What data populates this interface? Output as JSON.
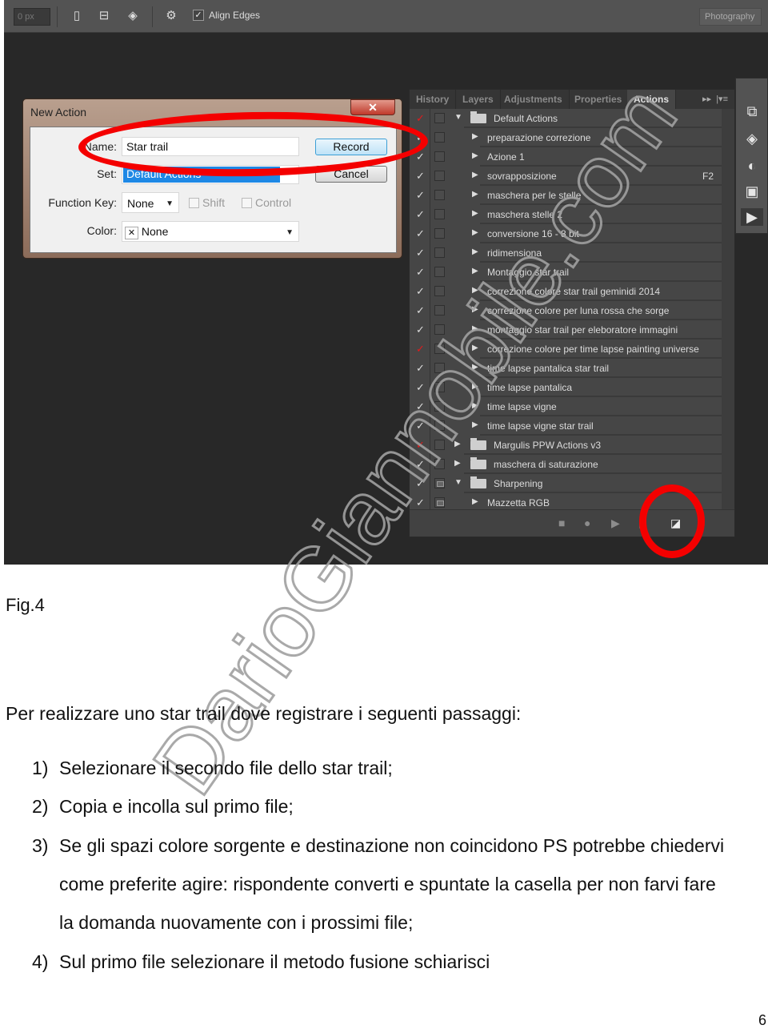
{
  "toolbar": {
    "px_value": "0 px",
    "align_edges_label": "Align Edges",
    "align_edges_checked": true,
    "workspace": "Photography"
  },
  "dialog": {
    "title": "New Action",
    "close": "✕",
    "name_label": "Name:",
    "name_value": "Star trail",
    "set_label": "Set:",
    "set_value": "Default Actions",
    "function_key_label": "Function Key:",
    "function_key_value": "None",
    "shift_label": "Shift",
    "control_label": "Control",
    "color_label": "Color:",
    "color_value": "None",
    "record": "Record",
    "cancel": "Cancel"
  },
  "panel": {
    "tabs": [
      "History",
      "Layers",
      "Adjustments",
      "Properties",
      "Actions"
    ],
    "active_tab": "Actions",
    "rows": [
      {
        "type": "set",
        "name": "Default Actions",
        "check": "red",
        "expanded": true
      },
      {
        "type": "action",
        "name": "preparazione correzione",
        "check": "white"
      },
      {
        "type": "action",
        "name": "Azione 1",
        "check": "white"
      },
      {
        "type": "action",
        "name": "sovrapposizione",
        "check": "white",
        "fkey": "F2"
      },
      {
        "type": "action",
        "name": "maschera per le stelle",
        "check": "white"
      },
      {
        "type": "action",
        "name": "maschera stelle 2",
        "check": "white"
      },
      {
        "type": "action",
        "name": "conversione 16 - 8 bit",
        "check": "white"
      },
      {
        "type": "action",
        "name": "ridimensiona",
        "check": "white"
      },
      {
        "type": "action",
        "name": "Montaggio star trail",
        "check": "white"
      },
      {
        "type": "action",
        "name": "correzione colore star trail geminidi 2014",
        "check": "white"
      },
      {
        "type": "action",
        "name": "correzione colore per luna rossa che sorge",
        "check": "white"
      },
      {
        "type": "action",
        "name": "montaggio star trail per eleboratore immagini",
        "check": "white"
      },
      {
        "type": "action",
        "name": "correzione colore per time lapse painting universe",
        "check": "red"
      },
      {
        "type": "action",
        "name": "time lapse pantalica star trail",
        "check": "white"
      },
      {
        "type": "action",
        "name": "time lapse pantalica",
        "check": "white"
      },
      {
        "type": "action",
        "name": "time lapse vigne",
        "check": "white"
      },
      {
        "type": "action",
        "name": "time lapse vigne star trail",
        "check": "white"
      },
      {
        "type": "set",
        "name": "Margulis PPW Actions v3",
        "check": "red",
        "expanded": false
      },
      {
        "type": "set",
        "name": "maschera di saturazione",
        "check": "white",
        "expanded": false
      },
      {
        "type": "set",
        "name": "Sharpening",
        "check": "white",
        "expanded": true,
        "dialog_toggle": true
      },
      {
        "type": "action",
        "name": "Mazzetta RGB",
        "check": "white",
        "dialog_toggle": true
      }
    ],
    "footer_icons": [
      "stop-icon",
      "record-icon",
      "play-icon",
      "new-set-icon",
      "new-action-icon"
    ]
  },
  "dock_icons": [
    "history-icon",
    "layers-icon",
    "adjustments-icon",
    "properties-icon",
    "actions-icon"
  ],
  "colors": {
    "annotation_red": "#f40000",
    "ps_dark": "#282828",
    "panel": "#464646"
  },
  "caption": "Fig.4",
  "intro": "Per realizzare uno star trail dove registrare i seguenti passaggi:",
  "steps": [
    {
      "n": "1)",
      "lines": [
        "Selezionare il secondo file dello star trail;"
      ]
    },
    {
      "n": "2)",
      "lines": [
        "Copia e incolla sul primo file;"
      ]
    },
    {
      "n": "3)",
      "lines": [
        "Se gli spazi colore sorgente e destinazione non coincidono PS potrebbe chiedervi",
        "come preferite agire: rispondente converti e spuntate la casella per non farvi fare",
        "la domanda nuovamente con i prossimi file;"
      ]
    },
    {
      "n": "4)",
      "lines": [
        "Sul primo file selezionare il metodo fusione schiarisci"
      ]
    }
  ],
  "page_number": "6",
  "watermark": "DarioGiannobile.com"
}
